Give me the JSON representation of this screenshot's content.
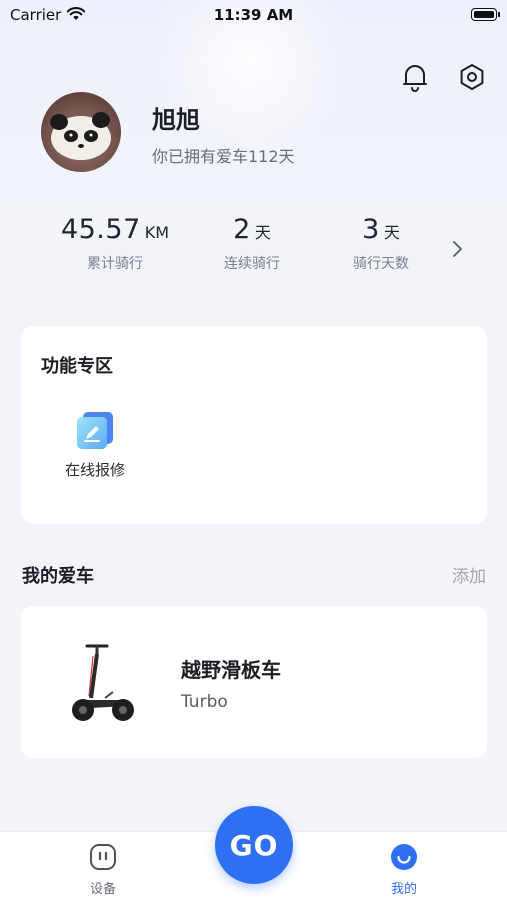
{
  "status_bar": {
    "carrier": "Carrier",
    "time": "11:39 AM"
  },
  "header": {
    "bell_icon": "bell-icon",
    "settings_icon": "settings-hex-icon"
  },
  "profile": {
    "name": "旭旭",
    "subtitle": "你已拥有爱车112天"
  },
  "stats": [
    {
      "value": "45.57",
      "unit": "KM",
      "label": "累计骑行"
    },
    {
      "value": "2",
      "unit": "天",
      "label": "连续骑行"
    },
    {
      "value": "3",
      "unit": "天",
      "label": "骑行天数"
    }
  ],
  "functions": {
    "title": "功能专区",
    "items": [
      {
        "label": "在线报修",
        "icon": "repair-edit-icon"
      }
    ]
  },
  "my_cars": {
    "title": "我的爱车",
    "add_label": "添加",
    "cars": [
      {
        "name": "越野滑板车",
        "model": "Turbo"
      }
    ]
  },
  "tabbar": {
    "tabs": [
      {
        "label": "设备",
        "icon": "device-face-icon",
        "active": false
      },
      {
        "label": "我的",
        "icon": "smile-icon",
        "active": true
      }
    ],
    "go_label": "GO"
  },
  "colors": {
    "accent": "#2f6ff4",
    "text": "#1d1d26",
    "muted": "#7c7f88"
  }
}
